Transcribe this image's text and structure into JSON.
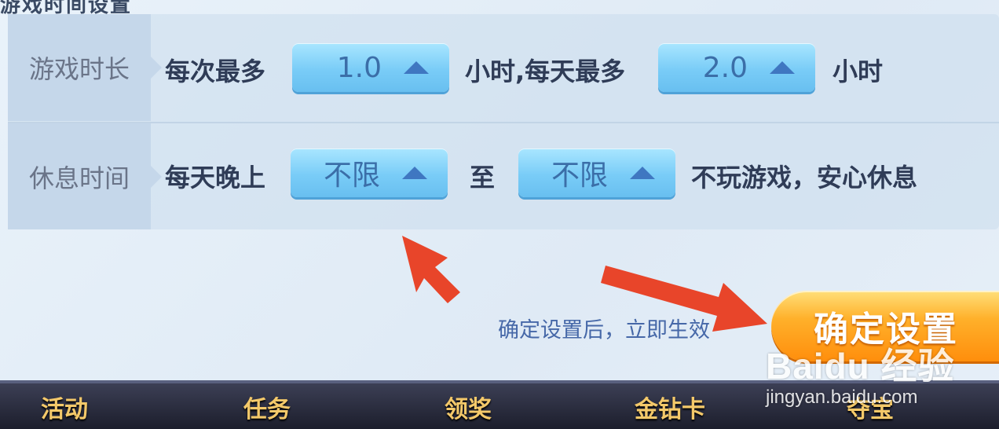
{
  "header": {
    "title_cut": "游戏时间设置"
  },
  "rows": [
    {
      "label": "游戏时长",
      "text_a": "每次最多",
      "select_a": "1.0",
      "text_b": "小时,每天最多",
      "select_b": "2.0",
      "text_c": "小时"
    },
    {
      "label": "休息时间",
      "text_a": "每天晚上",
      "select_a": "不限",
      "text_b": "至",
      "select_b": "不限",
      "text_c": "不玩游戏，安心休息"
    }
  ],
  "footer": {
    "note": "确定设置后，立即生效",
    "confirm_label": "确定设置"
  },
  "bottom_nav": [
    "活动",
    "任务",
    "领奖",
    "金钻卡",
    "夺宝"
  ],
  "watermark": {
    "brand": "Baidu 经验",
    "url": "jingyan.baidu.com"
  },
  "colors": {
    "select_bg": "#79ccf7",
    "confirm_bg": "#ff9f1a",
    "arrow": "#e8452a",
    "nav_text": "#f4c96a"
  },
  "icons": [
    "chevron-up-icon",
    "arrow-pointer-icon"
  ]
}
